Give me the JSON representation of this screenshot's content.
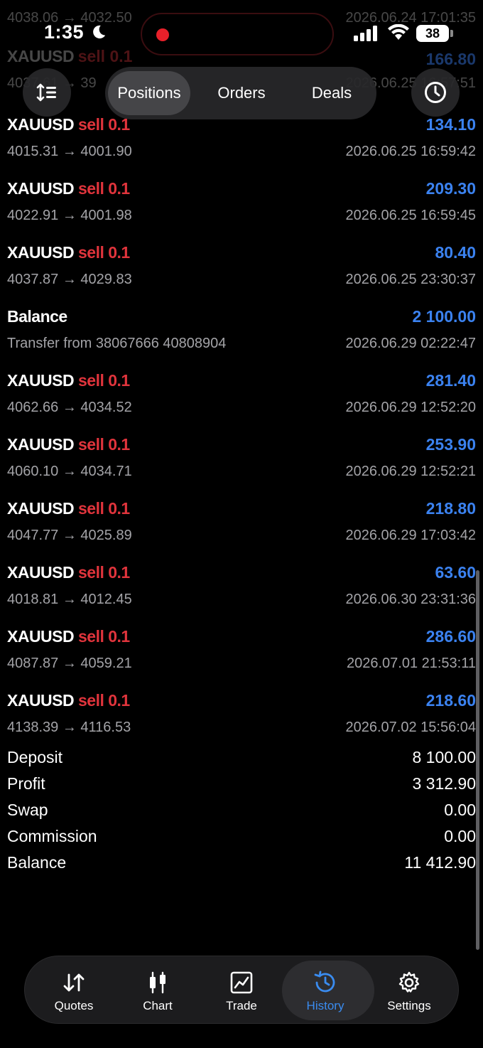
{
  "status_bar": {
    "time": "1:35",
    "battery": "38"
  },
  "ghost_rows": [
    {
      "left": "4038.06 → 4032.50",
      "right": "2026.06.24 17:01:35"
    },
    {
      "symbol": "XAUUSD",
      "side": "sell 0.1",
      "profit": "166.80"
    },
    {
      "left": "4037.61 → 39",
      "right": "2026.06.25 16:57:51"
    }
  ],
  "header": {
    "segments": [
      "Positions",
      "Orders",
      "Deals"
    ],
    "active_segment": "Positions"
  },
  "deals": [
    {
      "symbol": "XAUUSD",
      "side": "sell 0.1",
      "profit": "134.10",
      "prices": "4015.31 → 4001.90",
      "time": "2026.06.25 16:59:42"
    },
    {
      "symbol": "XAUUSD",
      "side": "sell 0.1",
      "profit": "209.30",
      "prices": "4022.91 → 4001.98",
      "time": "2026.06.25 16:59:45"
    },
    {
      "symbol": "XAUUSD",
      "side": "sell 0.1",
      "profit": "80.40",
      "prices": "4037.87 → 4029.83",
      "time": "2026.06.25 23:30:37"
    },
    {
      "symbol": "Balance",
      "side": "",
      "profit": "2 100.00",
      "prices": "Transfer from 38067666 40808904",
      "time": "2026.06.29 02:22:47"
    },
    {
      "symbol": "XAUUSD",
      "side": "sell 0.1",
      "profit": "281.40",
      "prices": "4062.66 → 4034.52",
      "time": "2026.06.29 12:52:20"
    },
    {
      "symbol": "XAUUSD",
      "side": "sell 0.1",
      "profit": "253.90",
      "prices": "4060.10 → 4034.71",
      "time": "2026.06.29 12:52:21"
    },
    {
      "symbol": "XAUUSD",
      "side": "sell 0.1",
      "profit": "218.80",
      "prices": "4047.77 → 4025.89",
      "time": "2026.06.29 17:03:42"
    },
    {
      "symbol": "XAUUSD",
      "side": "sell 0.1",
      "profit": "63.60",
      "prices": "4018.81 → 4012.45",
      "time": "2026.06.30 23:31:36"
    },
    {
      "symbol": "XAUUSD",
      "side": "sell 0.1",
      "profit": "286.60",
      "prices": "4087.87 → 4059.21",
      "time": "2026.07.01 21:53:11"
    },
    {
      "symbol": "XAUUSD",
      "side": "sell 0.1",
      "profit": "218.60",
      "prices": "4138.39 → 4116.53",
      "time": "2026.07.02 15:56:04"
    }
  ],
  "summary": [
    {
      "label": "Deposit",
      "value": "8 100.00"
    },
    {
      "label": "Profit",
      "value": "3 312.90"
    },
    {
      "label": "Swap",
      "value": "0.00"
    },
    {
      "label": "Commission",
      "value": "0.00"
    },
    {
      "label": "Balance",
      "value": "11 412.90"
    }
  ],
  "tabs": [
    {
      "label": "Quotes",
      "icon": "quotes-arrows-icon"
    },
    {
      "label": "Chart",
      "icon": "candlestick-icon"
    },
    {
      "label": "Trade",
      "icon": "trade-chart-icon"
    },
    {
      "label": "History",
      "icon": "history-clock-icon"
    },
    {
      "label": "Settings",
      "icon": "gear-icon"
    }
  ],
  "active_tab": "History",
  "colors": {
    "profit": "#3b82f0",
    "sell": "#e0343c",
    "active_tab": "#3a8cf0",
    "background": "#000000"
  }
}
